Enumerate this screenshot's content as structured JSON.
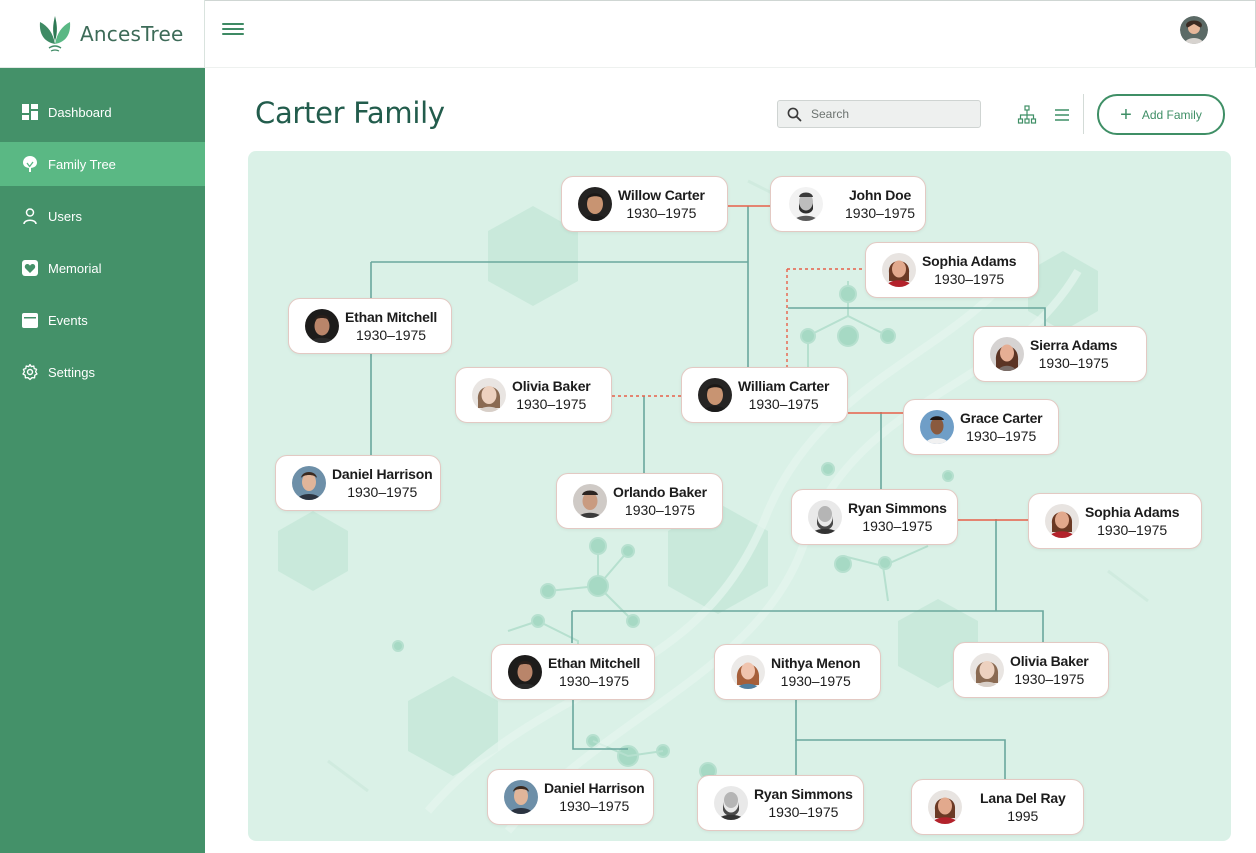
{
  "app": {
    "name": "AncesTree"
  },
  "sidebar": {
    "items": [
      {
        "label": "Dashboard",
        "icon": "dashboard-icon"
      },
      {
        "label": "Family Tree",
        "icon": "tree-icon",
        "active": true
      },
      {
        "label": "Users",
        "icon": "user-icon"
      },
      {
        "label": "Memorial",
        "icon": "heart-icon"
      },
      {
        "label": "Events",
        "icon": "calendar-icon"
      },
      {
        "label": "Settings",
        "icon": "gear-icon"
      }
    ]
  },
  "header": {
    "title": "Carter Family",
    "search_placeholder": "Search",
    "add_label": "Add Family"
  },
  "colors": {
    "sidebar": "#449169",
    "active": "#5ab884",
    "accent": "#3f8f66",
    "canvas": "#daf1e7",
    "line": "#5a9e92",
    "spouse_line": "#e8614a"
  },
  "tree": {
    "people": [
      {
        "id": "willow",
        "name": "Willow Carter",
        "years": "1930–1975"
      },
      {
        "id": "john",
        "name": "John Doe",
        "years": "1930–1975"
      },
      {
        "id": "sophia1",
        "name": "Sophia Adams",
        "years": "1930–1975"
      },
      {
        "id": "ethan1",
        "name": "Ethan Mitchell",
        "years": "1930–1975"
      },
      {
        "id": "sierra",
        "name": "Sierra Adams",
        "years": "1930–1975"
      },
      {
        "id": "olivia1",
        "name": "Olivia Baker",
        "years": "1930–1975"
      },
      {
        "id": "william",
        "name": "William Carter",
        "years": "1930–1975"
      },
      {
        "id": "grace",
        "name": "Grace Carter",
        "years": "1930–1975"
      },
      {
        "id": "daniel1",
        "name": "Daniel Harrison",
        "years": "1930–1975"
      },
      {
        "id": "orlando",
        "name": "Orlando Baker",
        "years": "1930–1975"
      },
      {
        "id": "ryan1",
        "name": "Ryan Simmons",
        "years": "1930–1975"
      },
      {
        "id": "sophia2",
        "name": "Sophia Adams",
        "years": "1930–1975"
      },
      {
        "id": "ethan2",
        "name": "Ethan Mitchell",
        "years": "1930–1975"
      },
      {
        "id": "nithya",
        "name": "Nithya Menon",
        "years": "1930–1975"
      },
      {
        "id": "olivia2",
        "name": "Olivia Baker",
        "years": "1930–1975"
      },
      {
        "id": "daniel2",
        "name": "Daniel Harrison",
        "years": "1930–1975"
      },
      {
        "id": "ryan2",
        "name": "Ryan Simmons",
        "years": "1930–1975"
      },
      {
        "id": "lana",
        "name": "Lana Del Ray",
        "years": "1995"
      }
    ]
  }
}
